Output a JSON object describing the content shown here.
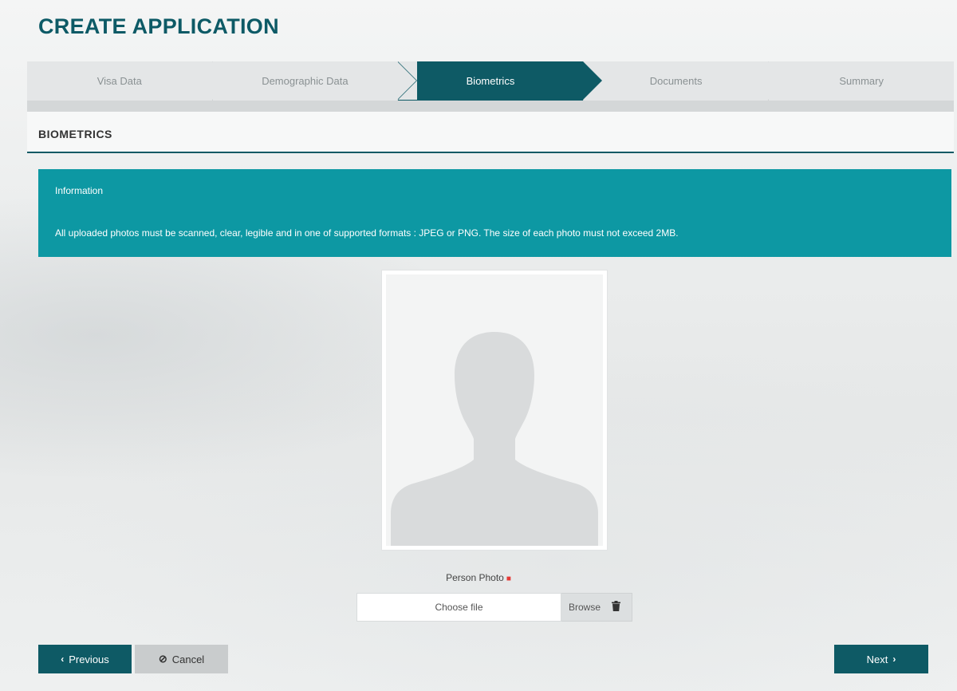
{
  "page": {
    "title": "CREATE APPLICATION"
  },
  "steps": [
    {
      "label": "Visa Data",
      "active": false
    },
    {
      "label": "Demographic Data",
      "active": false
    },
    {
      "label": "Biometrics",
      "active": true
    },
    {
      "label": "Documents",
      "active": false
    },
    {
      "label": "Summary",
      "active": false
    }
  ],
  "section": {
    "title": "BIOMETRICS"
  },
  "info": {
    "title": "Information",
    "text": "All uploaded photos must be scanned, clear, legible and in one of supported formats : JPEG or PNG. The size of each photo must not exceed 2MB."
  },
  "photo": {
    "label": "Person Photo",
    "required_mark": "■",
    "file_placeholder": "Choose file",
    "browse_label": "Browse",
    "icon": "person-silhouette-icon"
  },
  "buttons": {
    "previous_icon": "‹",
    "previous": "Previous",
    "cancel_icon": "⊘",
    "cancel": "Cancel",
    "next": "Next",
    "next_icon": "›"
  },
  "colors": {
    "primary": "#0e5a65",
    "info": "#0d98a3",
    "step_inactive": "#e4e6e7",
    "required": "#e53935"
  }
}
